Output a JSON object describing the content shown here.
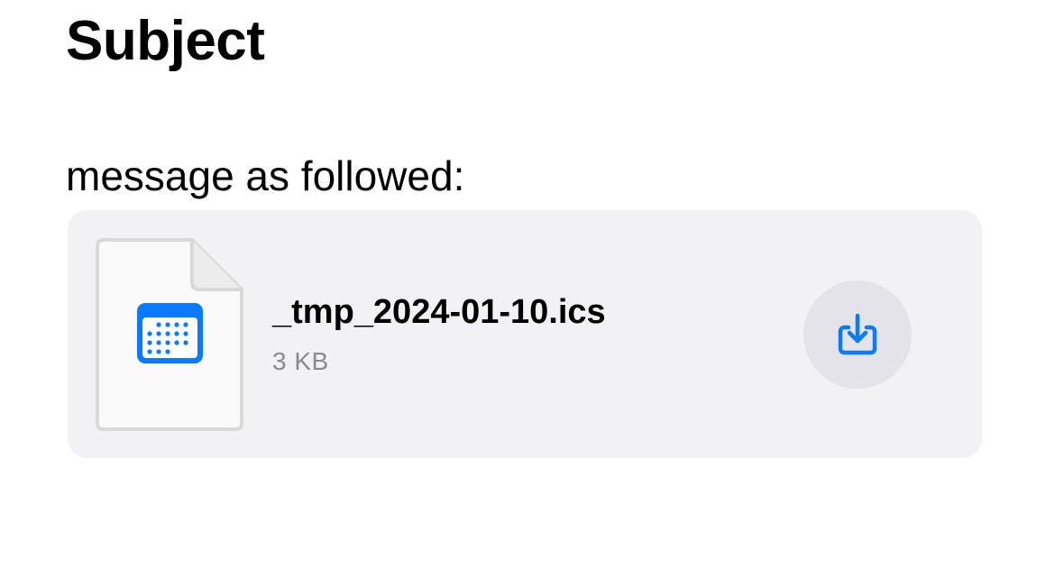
{
  "message": {
    "subject": "Subject",
    "body": "message as followed:"
  },
  "attachment": {
    "file_name": "_tmp_2024-01-10.ics",
    "file_size": "3 KB",
    "file_icon": "calendar-icon",
    "action_icon": "download-icon"
  },
  "colors": {
    "accent": "#0a7aff",
    "card_background": "#f2f2f5",
    "button_background": "#e3e3e8",
    "secondary_text": "#8a8a8e"
  }
}
